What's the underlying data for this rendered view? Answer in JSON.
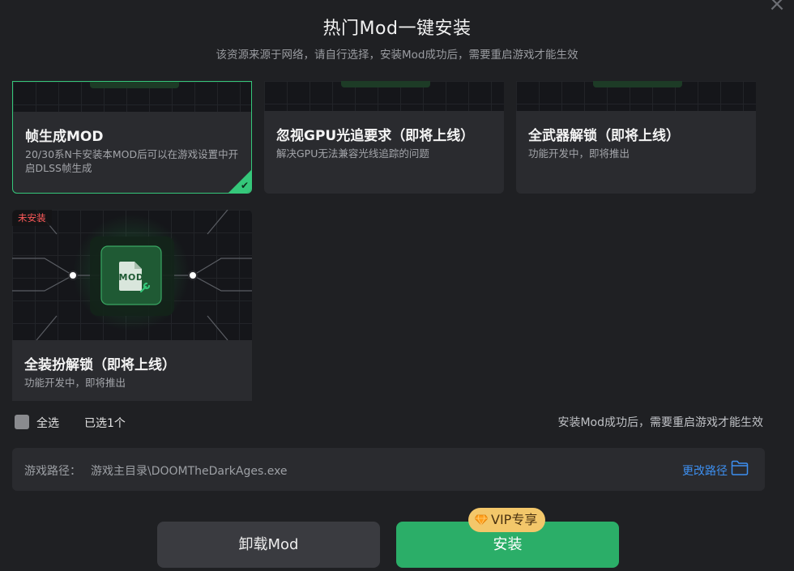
{
  "dialog": {
    "title": "热门Mod一键安装",
    "subtitle": "该资源来源于网络，请自行选择，安装Mod成功后，需要重启游戏才能生效",
    "close_icon": "×"
  },
  "cards": [
    {
      "name": "帧生成MOD",
      "desc": "20/30系N卡安装本MOD后可以在游戏设置中开启DLSS帧生成",
      "selected": true
    },
    {
      "name": "忽视GPU光追要求（即将上线）",
      "desc": "解决GPU无法兼容光线追踪的问题",
      "selected": false
    },
    {
      "name": "全武器解锁（即将上线）",
      "desc": "功能开发中，即将推出",
      "selected": false
    },
    {
      "name": "全装扮解锁（即将上线）",
      "desc": "功能开发中，即将推出",
      "status": "未安装",
      "icon_text": "MOD",
      "selected": false
    }
  ],
  "selection": {
    "select_all_label": "全选",
    "selected_count_text": "已选1个",
    "restart_note": "安装Mod成功后，需要重启游戏才能生效"
  },
  "game_path": {
    "label": "游戏路径：",
    "value": "游戏主目录\\DOOMTheDarkAges.exe",
    "change_label": "更改路径"
  },
  "buttons": {
    "uninstall_label": "卸载Mod",
    "install_label": "安装",
    "vip_badge": "VIP专享"
  },
  "colors": {
    "accent_green": "#2bae68",
    "selected_border": "#35c77a",
    "link_blue": "#3d8ff0",
    "vip_gold": "#f3c76a",
    "status_red": "#ff5a5a"
  }
}
